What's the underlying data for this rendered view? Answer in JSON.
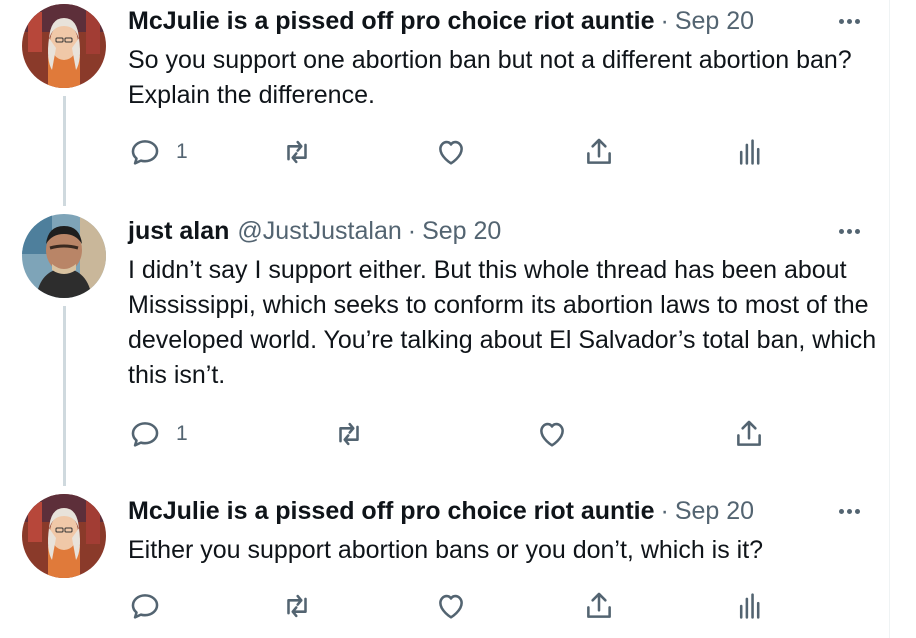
{
  "tweets": [
    {
      "name": "McJulie is a pissed off pro choice riot auntie",
      "handle": "",
      "date": "Sep 20",
      "text": "So you support one abortion ban but not a different abortion ban? Explain the difference.",
      "reply_count": "1",
      "avatar": "mcjulie-avatar",
      "actions": [
        "reply-icon",
        "retweet-icon",
        "like-icon",
        "share-icon",
        "analytics-icon"
      ]
    },
    {
      "name": "just alan",
      "handle": "@JustJustalan",
      "date": "Sep 20",
      "text": "I didn’t say I support either. But this whole thread has been about Mississippi, which seeks to conform its abortion laws to most of the developed world. You’re talking about El Salvador’s total ban, which this isn’t.",
      "reply_count": "1",
      "avatar": "just-alan-avatar",
      "actions": [
        "reply-icon",
        "retweet-icon",
        "like-icon",
        "share-icon"
      ]
    },
    {
      "name": "McJulie is a pissed off pro choice riot auntie",
      "handle": "",
      "date": "Sep 20",
      "text": "Either you support abortion bans or you don’t, which is it?",
      "reply_count": "",
      "avatar": "mcjulie-avatar",
      "actions": [
        "reply-icon",
        "retweet-icon",
        "like-icon",
        "share-icon",
        "analytics-icon"
      ]
    }
  ],
  "colors": {
    "text": "#0f1419",
    "secondary": "#536471",
    "thread_line": "#cfd9de",
    "background": "#ffffff"
  }
}
